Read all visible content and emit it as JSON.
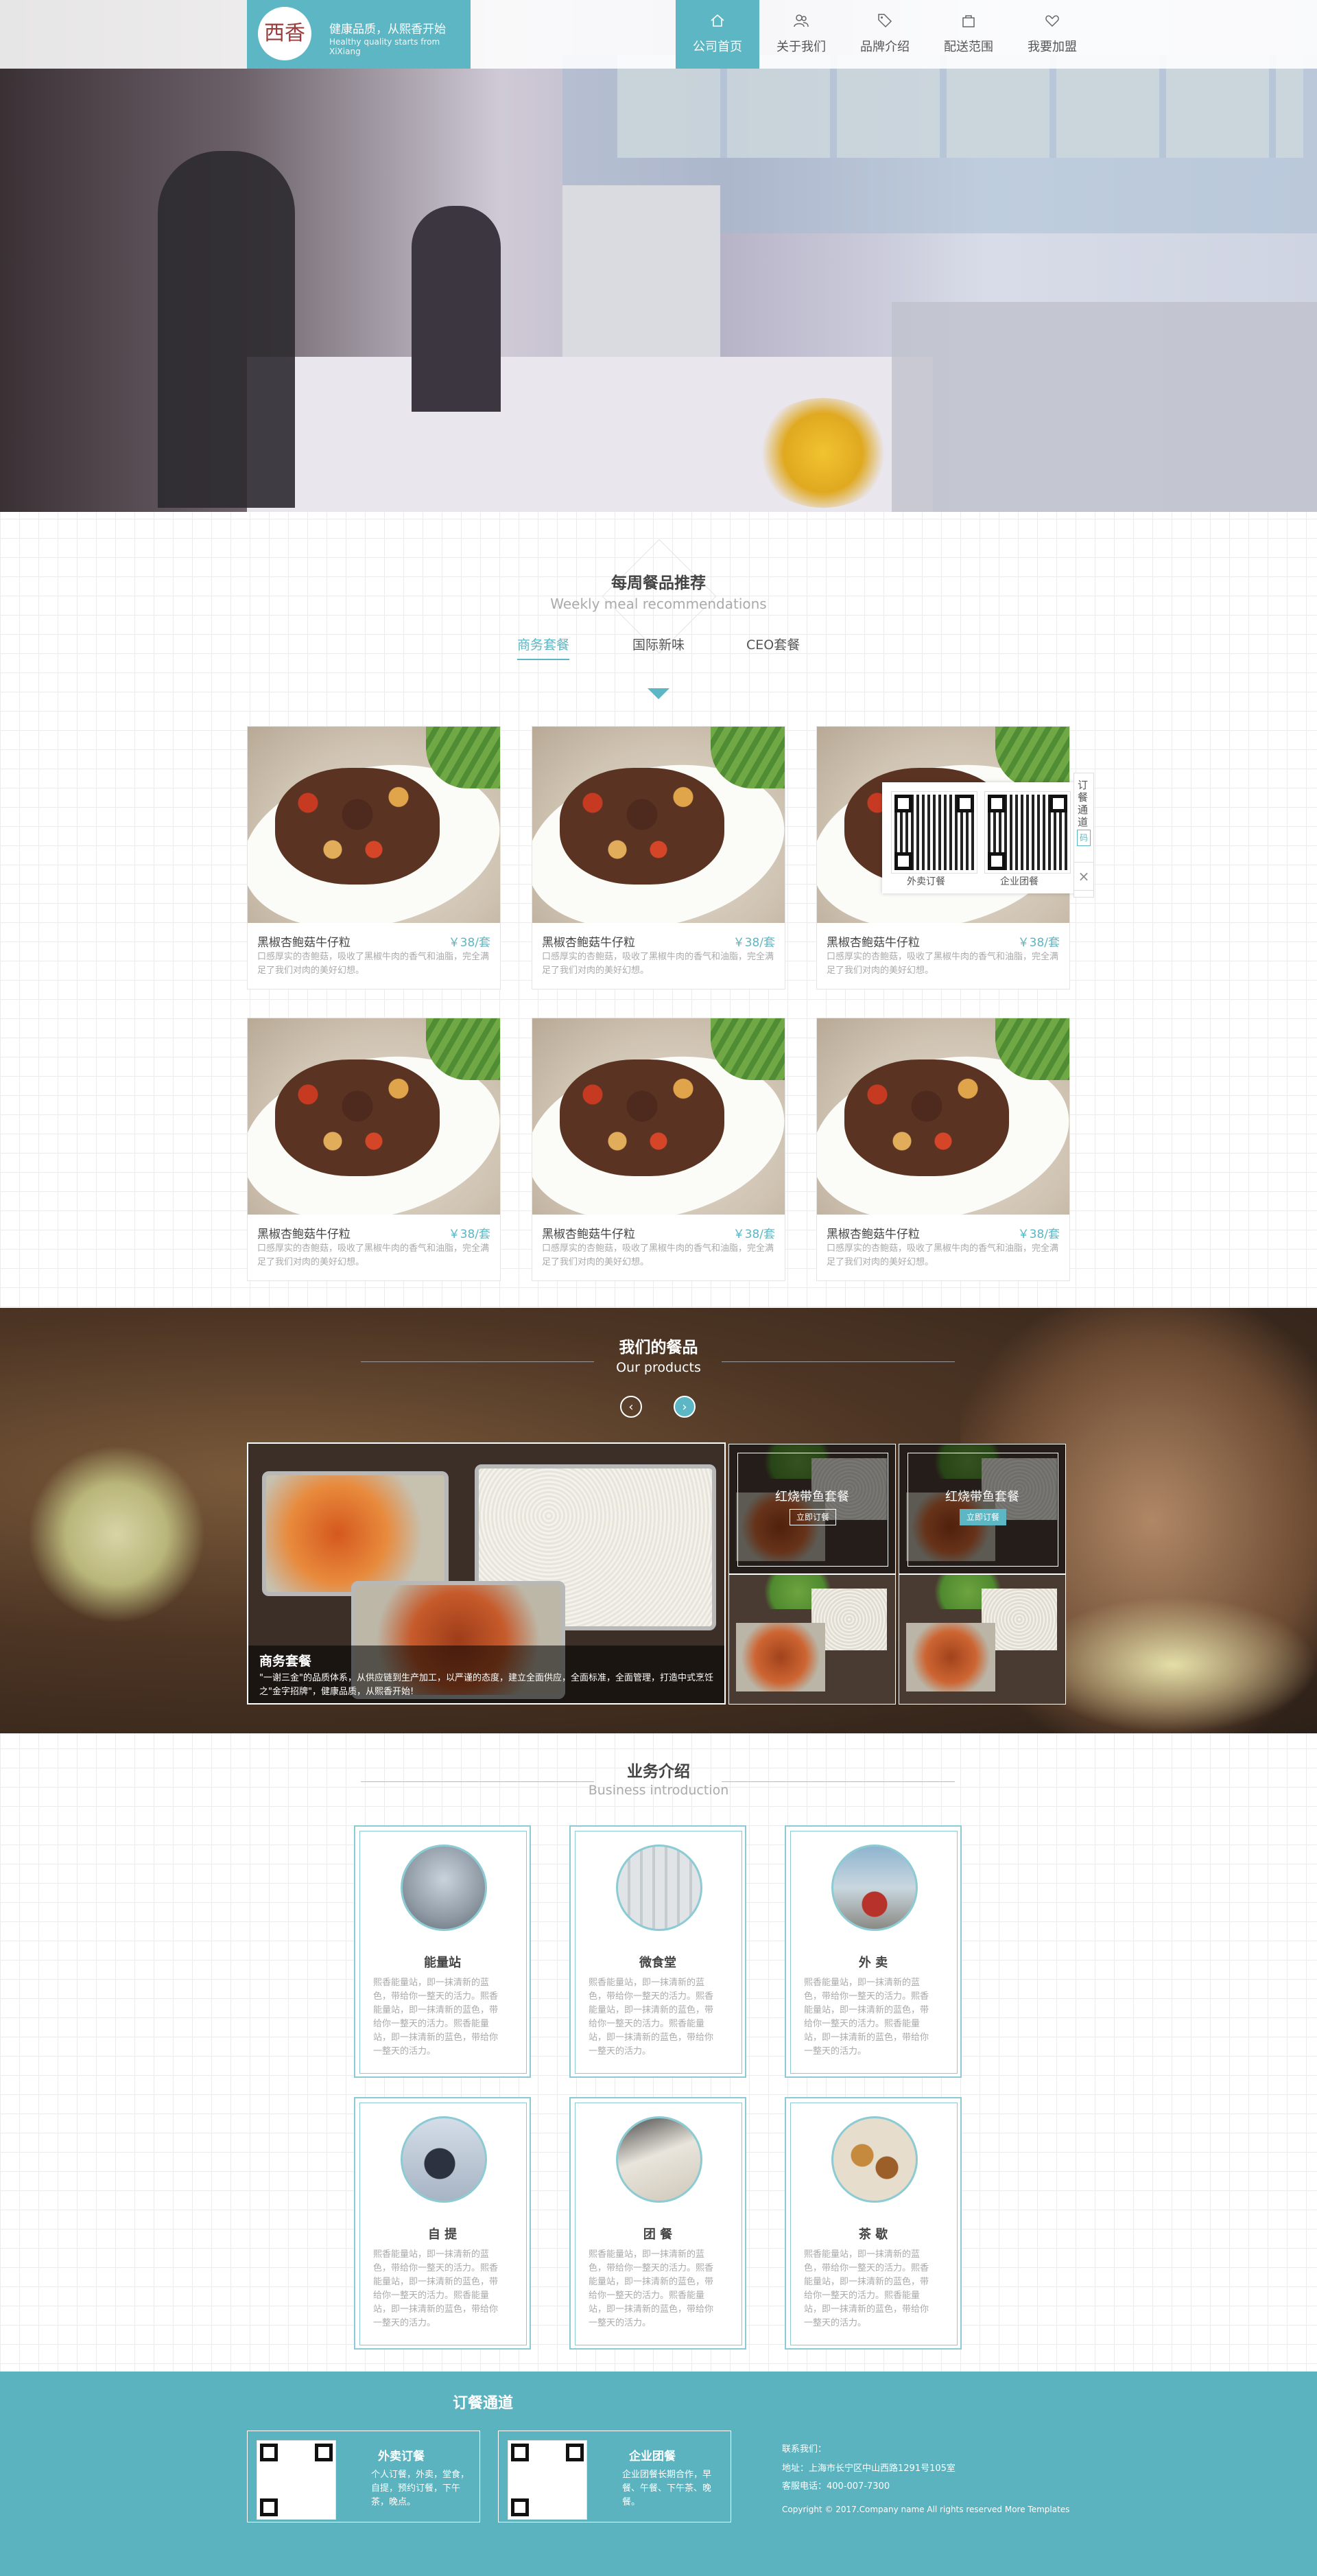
{
  "brand": {
    "logo_text": "西香",
    "slogan_cn": "健康品质，从熙香开始",
    "slogan_en": "Healthy quality starts from XiXiang"
  },
  "nav": [
    {
      "label": "公司首页",
      "icon": "home-icon"
    },
    {
      "label": "关于我们",
      "icon": "people-icon"
    },
    {
      "label": "品牌介绍",
      "icon": "tag-icon"
    },
    {
      "label": "配送范围",
      "icon": "bag-icon"
    },
    {
      "label": "我要加盟",
      "icon": "heart-icon"
    }
  ],
  "weekly": {
    "title": "每周餐品推荐",
    "subtitle": "Weekly meal recommendations",
    "tabs": [
      "商务套餐",
      "国际新味",
      "CEO套餐"
    ],
    "cards": [
      {
        "name": "黑椒杏鲍菇牛仔粒",
        "price": "￥38/套",
        "desc": "口感厚实的杏鲍菇，吸收了黑椒牛肉的香气和油脂，完全满足了我们对肉的美好幻想。"
      },
      {
        "name": "黑椒杏鲍菇牛仔粒",
        "price": "￥38/套",
        "desc": "口感厚实的杏鲍菇，吸收了黑椒牛肉的香气和油脂，完全满足了我们对肉的美好幻想。"
      },
      {
        "name": "黑椒杏鲍菇牛仔粒",
        "price": "￥38/套",
        "desc": "口感厚实的杏鲍菇，吸收了黑椒牛肉的香气和油脂，完全满足了我们对肉的美好幻想。"
      },
      {
        "name": "黑椒杏鲍菇牛仔粒",
        "price": "￥38/套",
        "desc": "口感厚实的杏鲍菇，吸收了黑椒牛肉的香气和油脂，完全满足了我们对肉的美好幻想。"
      },
      {
        "name": "黑椒杏鲍菇牛仔粒",
        "price": "￥38/套",
        "desc": "口感厚实的杏鲍菇，吸收了黑椒牛肉的香气和油脂，完全满足了我们对肉的美好幻想。"
      },
      {
        "name": "黑椒杏鲍菇牛仔粒",
        "price": "￥38/套",
        "desc": "口感厚实的杏鲍菇，吸收了黑椒牛肉的香气和油脂，完全满足了我们对肉的美好幻想。"
      }
    ]
  },
  "float_widget": {
    "side_label": "订餐通道",
    "qr_button": "码",
    "close": "×",
    "qr_labels": [
      "外卖订餐",
      "企业团餐"
    ]
  },
  "products": {
    "title": "我们的餐品",
    "subtitle": "Our products",
    "prev": "‹",
    "next": "›",
    "featured": {
      "title": "商务套餐",
      "text": "\"一谢三金\"的品质体系，从供应链到生产加工，以严谨的态度，建立全面供应，全面标准，全面管理，打造中式烹饪之\"金字招牌\"，健康品质，从熙香开始!"
    },
    "thumbs": [
      {
        "title": "红烧带鱼套餐",
        "button": "立即订餐"
      },
      {
        "title": "红烧带鱼套餐",
        "button": "立即订餐"
      }
    ]
  },
  "business": {
    "title": "业务介绍",
    "subtitle": "Business introduction",
    "items": [
      {
        "title": "能量站",
        "desc": "熙香能量站，即一抹清新的蓝色，带给你一整天的活力。熙香能量站，即一抹清新的蓝色，带给你一整天的活力。熙香能量站，即一抹清新的蓝色，带给你一整天的活力。"
      },
      {
        "title": "微食堂",
        "desc": "熙香能量站，即一抹清新的蓝色，带给你一整天的活力。熙香能量站，即一抹清新的蓝色，带给你一整天的活力。熙香能量站，即一抹清新的蓝色，带给你一整天的活力。"
      },
      {
        "title": "外 卖",
        "desc": "熙香能量站，即一抹清新的蓝色，带给你一整天的活力。熙香能量站，即一抹清新的蓝色，带给你一整天的活力。熙香能量站，即一抹清新的蓝色，带给你一整天的活力。"
      },
      {
        "title": "自 提",
        "desc": "熙香能量站，即一抹清新的蓝色，带给你一整天的活力。熙香能量站，即一抹清新的蓝色，带给你一整天的活力。熙香能量站，即一抹清新的蓝色，带给你一整天的活力。"
      },
      {
        "title": "团 餐",
        "desc": "熙香能量站，即一抹清新的蓝色，带给你一整天的活力。熙香能量站，即一抹清新的蓝色，带给你一整天的活力。熙香能量站，即一抹清新的蓝色，带给你一整天的活力。"
      },
      {
        "title": "茶 歇",
        "desc": "熙香能量站，即一抹清新的蓝色，带给你一整天的活力。熙香能量站，即一抹清新的蓝色，带给你一整天的活力。熙香能量站，即一抹清新的蓝色，带给你一整天的活力。"
      }
    ]
  },
  "footer": {
    "title": "订餐通道",
    "boxes": [
      {
        "title": "外卖订餐",
        "text": "个人订餐，外卖，堂食，自提，预约订餐，下午茶，晚点。"
      },
      {
        "title": "企业团餐",
        "text": "企业团餐长期合作，早餐、午餐、下午茶、晚餐。"
      }
    ],
    "contact_title": "联系我们：",
    "address": "地址：上海市长宁区中山西路1291号105室",
    "phone": "客服电话：400-007-7300",
    "copyright": "Copyright © 2017.Company name All rights reserved More Templates"
  },
  "colors": {
    "accent": "#5cb6c3",
    "footer_bg": "#5bb3bf",
    "price": "#5cb6c3"
  }
}
